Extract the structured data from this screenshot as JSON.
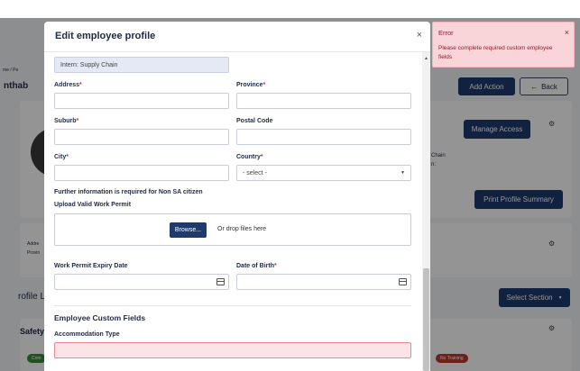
{
  "background": {
    "breadcrumb": "me / Pe",
    "page_title_fragment": "nthab",
    "add_action_label": "Add Action",
    "back_label": "Back",
    "manage_access_label": "Manage Access",
    "chain_fragment": "Chain",
    "colon_fragment": "n:",
    "print_profile_label": "Print Profile Summary",
    "address_fragment": "Addre",
    "province_fragment": "Provin",
    "profile_fragment": "rofile L",
    "select_section_label": "Select Section",
    "safety_fragment": "Safety",
    "pill_green_label": "Com",
    "pill_red_label": "No Training"
  },
  "modal": {
    "title": "Edit employee profile",
    "close_glyph": "×",
    "prefilled_value": "Intern: Supply Chain",
    "address": {
      "label": "Address",
      "req": "*",
      "value": ""
    },
    "province": {
      "label": "Province",
      "req": "*",
      "value": ""
    },
    "suburb": {
      "label": "Suburb",
      "req": "*",
      "value": ""
    },
    "postal_code": {
      "label": "Postal Code",
      "value": ""
    },
    "city": {
      "label": "City",
      "req": "*",
      "value": ""
    },
    "country": {
      "label": "Country",
      "req": "*",
      "selected": "- select -"
    },
    "non_sa_notice": "Further information is required for Non SA citizen",
    "upload_label": "Upload Valid Work Permit",
    "browse_label": "Browse...",
    "drop_text": "Or drop files here",
    "permit_expiry": {
      "label": "Work Permit Expiry Date",
      "value": ""
    },
    "dob": {
      "label": "Date of Birth",
      "req": "*",
      "value": ""
    },
    "custom_fields_title": "Employee Custom Fields",
    "accommodation": {
      "label": "Accommodation Type",
      "value": ""
    }
  },
  "toast": {
    "title": "Error",
    "close_glyph": "×",
    "message": "Please complete required custom employee fields"
  },
  "colors": {
    "primary": "#1e3a6e",
    "error_bg": "#f9d5d9",
    "error_field": "#fbe4e6",
    "prefilled_bg": "#e5e9f5"
  }
}
